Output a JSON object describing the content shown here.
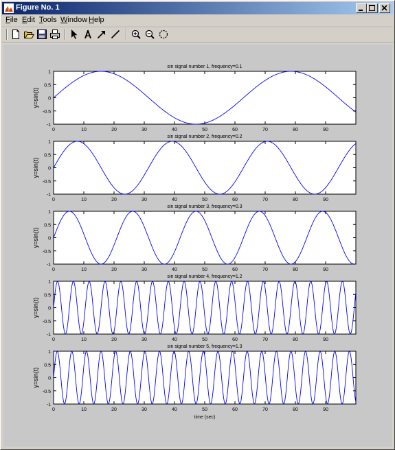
{
  "window": {
    "title": "Figure No. 1"
  },
  "menu": {
    "items": [
      "File",
      "Edit",
      "Tools",
      "Window",
      "Help"
    ],
    "mnemonics": [
      "F",
      "E",
      "T",
      "W",
      "H"
    ]
  },
  "toolbar": {
    "icons": [
      "new-figure-icon",
      "open-file-icon",
      "save-icon",
      "print-icon",
      "select-arrow-icon",
      "insert-text-icon",
      "insert-arrow-icon",
      "insert-line-icon",
      "zoom-in-icon",
      "zoom-out-icon",
      "rotate-3d-icon"
    ]
  },
  "colors": {
    "line": "#0000ff",
    "figure_bg": "#c8c8c8",
    "axes_bg": "#ffffff",
    "title_gradient_start": "#0a246a",
    "title_gradient_end": "#a6caf0"
  },
  "chart_data": [
    {
      "type": "line",
      "title": "sin signal number 1, frequency=0.1",
      "ylabel": "y=sin(t)",
      "xlabel": "",
      "frequency": 0.1,
      "xlim": [
        0,
        100
      ],
      "ylim": [
        -1,
        1
      ],
      "xticks": [
        "0",
        "10",
        "20",
        "30",
        "40",
        "50",
        "60",
        "70",
        "80",
        "90"
      ],
      "yticks": [
        "1",
        "0.5",
        "0",
        "-0.5",
        "-1"
      ]
    },
    {
      "type": "line",
      "title": "sin signal number 2, frequency=0.2",
      "ylabel": "y=sin(t)",
      "xlabel": "",
      "frequency": 0.2,
      "xlim": [
        0,
        100
      ],
      "ylim": [
        -1,
        1
      ],
      "xticks": [
        "0",
        "10",
        "20",
        "30",
        "40",
        "50",
        "60",
        "70",
        "80",
        "90"
      ],
      "yticks": [
        "1",
        "0.5",
        "0",
        "-0.5",
        "-1"
      ]
    },
    {
      "type": "line",
      "title": "sin signal number 3, frequency=0.3",
      "ylabel": "y=sin(t)",
      "xlabel": "",
      "frequency": 0.3,
      "xlim": [
        0,
        100
      ],
      "ylim": [
        -1,
        1
      ],
      "xticks": [
        "0",
        "10",
        "20",
        "30",
        "40",
        "50",
        "60",
        "70",
        "80",
        "90"
      ],
      "yticks": [
        "1",
        "0.5",
        "0",
        "-0.5",
        "-1"
      ]
    },
    {
      "type": "line",
      "title": "sin signal number 4, frequency=1.2",
      "ylabel": "y=sin(t)",
      "xlabel": "",
      "frequency": 1.2,
      "xlim": [
        0,
        100
      ],
      "ylim": [
        -1,
        1
      ],
      "xticks": [
        "0",
        "10",
        "20",
        "30",
        "40",
        "50",
        "60",
        "70",
        "80",
        "90"
      ],
      "yticks": [
        "1",
        "0.5",
        "0",
        "-0.5",
        "-1"
      ]
    },
    {
      "type": "line",
      "title": "sin signal number 5, frequency=1.3",
      "ylabel": "y=sin(t)",
      "xlabel": "time (sec)",
      "frequency": 1.3,
      "xlim": [
        0,
        100
      ],
      "ylim": [
        -1,
        1
      ],
      "xticks": [
        "0",
        "10",
        "20",
        "30",
        "40",
        "50",
        "60",
        "70",
        "80",
        "90"
      ],
      "yticks": [
        "1",
        "0.5",
        "0",
        "-0.5",
        "-1"
      ]
    }
  ]
}
